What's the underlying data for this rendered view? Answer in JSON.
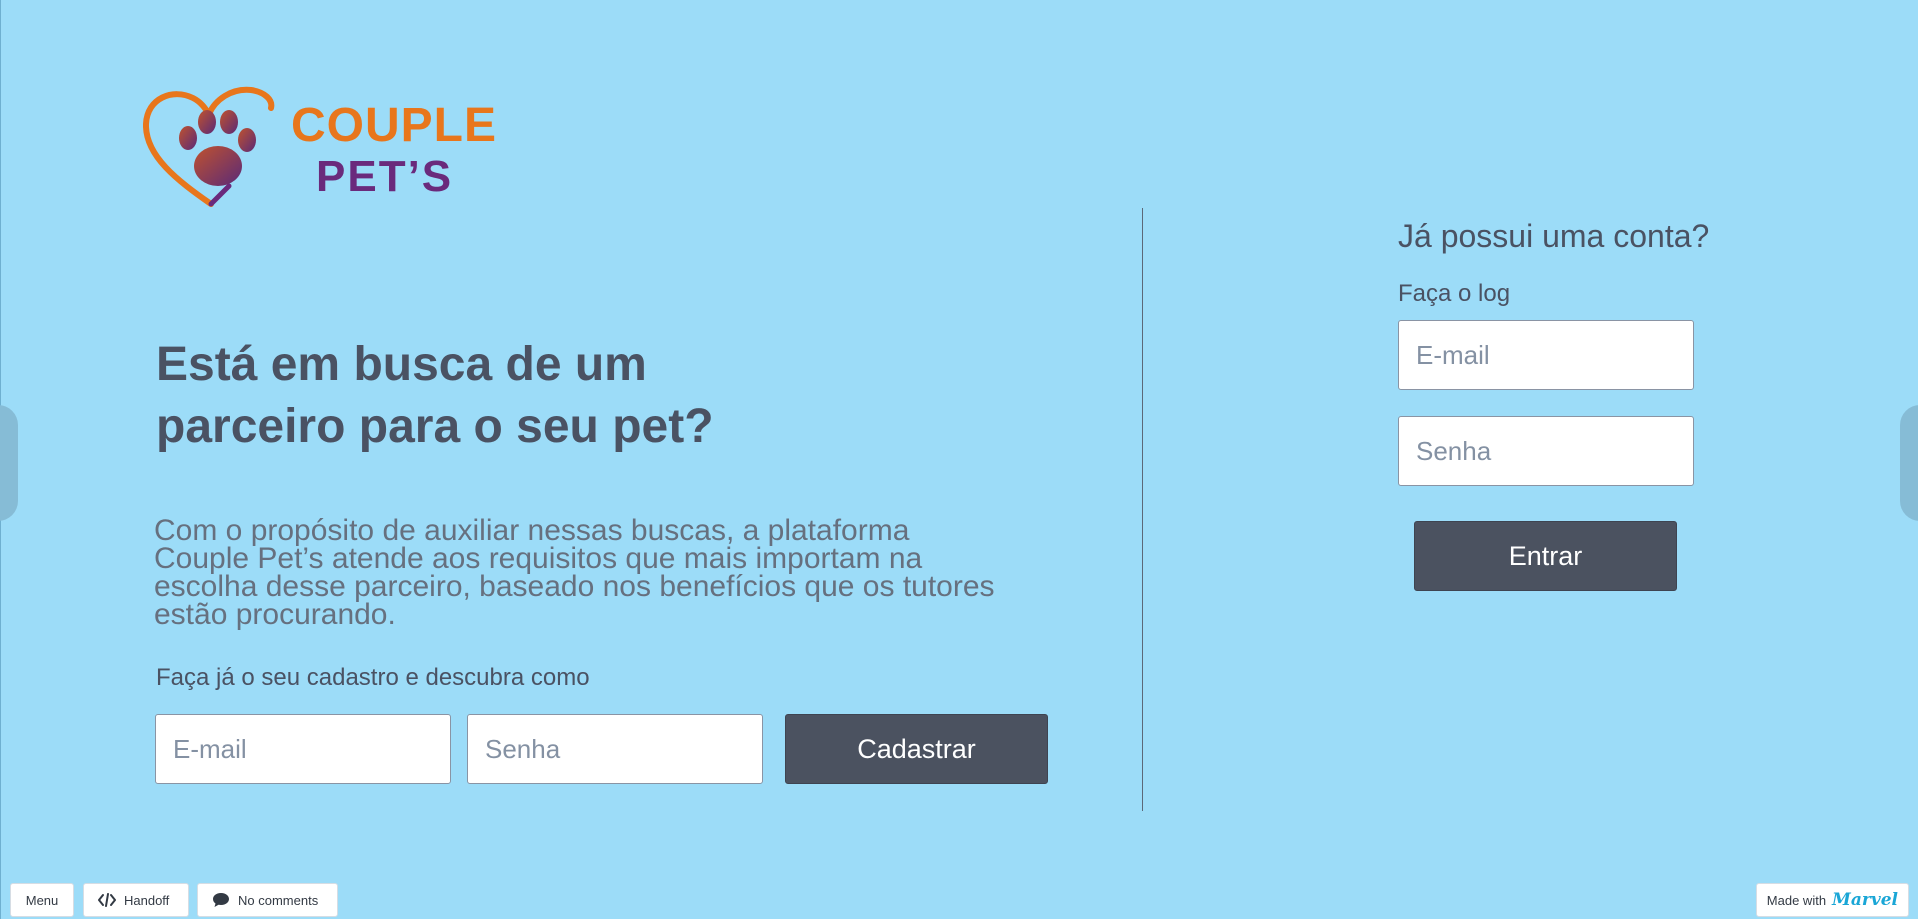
{
  "brand": {
    "line1": "COUPLE",
    "line2": "PET’S",
    "logo_icon": "heart-paw-icon",
    "colors": {
      "heart": "#e8761c",
      "paw": "#8a2f4a",
      "text_primary": "#e8761c",
      "text_secondary": "#6a2a7c"
    }
  },
  "hero": {
    "headline": "Está em busca de um parceiro para o seu pet?",
    "description": "Com o propósito de auxiliar nessas buscas, a plataforma Couple Pet’s atende aos requisitos que mais importam na escolha desse parceiro, baseado nos benefícios que os tutores estão procurando.",
    "signup_prompt": "Faça já o seu cadastro e descubra como"
  },
  "signup": {
    "email_placeholder": "E-mail",
    "password_placeholder": "Senha",
    "button_label": "Cadastrar"
  },
  "login": {
    "title": "Já possui uma conta?",
    "subtitle": "Faça o log",
    "email_placeholder": "E-mail",
    "password_placeholder": "Senha",
    "button_label": "Entrar"
  },
  "toolbar": {
    "menu_label": "Menu",
    "handoff_label": "Handoff",
    "comments_label": "No comments",
    "made_with_label": "Made with",
    "marvel_label": "Marvel"
  },
  "colors": {
    "background": "#9cdcf8",
    "button": "#4b5260",
    "text": "#4a5263"
  }
}
